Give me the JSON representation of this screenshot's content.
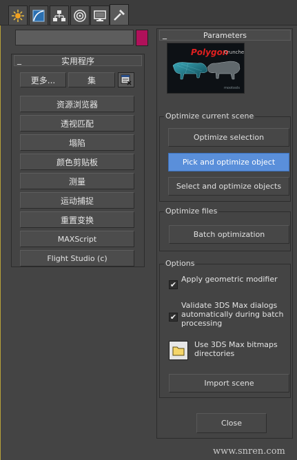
{
  "tabs": [
    {
      "icon": "create-icon"
    },
    {
      "icon": "modify-icon"
    },
    {
      "icon": "hierarchy-icon"
    },
    {
      "icon": "motion-icon"
    },
    {
      "icon": "display-icon"
    },
    {
      "icon": "utilities-icon",
      "active": true
    }
  ],
  "colors": {
    "swatch": "#b0115a",
    "accent_button": "#5a8fda",
    "logo_title": "#e12020"
  },
  "utilities": {
    "title": "实用程序",
    "more_label": "更多...",
    "sets_label": "集",
    "items": [
      "资源浏览器",
      "透视匹配",
      "塌陷",
      "颜色剪贴板",
      "测量",
      "运动捕捉",
      "重置变换",
      "MAXScript",
      "Flight Studio (c)"
    ]
  },
  "parameters": {
    "title": "Parameters",
    "logo": {
      "title": "Polygon",
      "subtitle": "Cruncher",
      "brand": "mootools"
    },
    "optimize_scene": {
      "label": "Optimize current scene",
      "buttons": [
        "Optimize selection",
        "Pick and optimize object",
        "Select and optimize objects"
      ],
      "active_index": 1
    },
    "optimize_files": {
      "label": "Optimize files",
      "batch_label": "Batch optimization"
    },
    "options": {
      "label": "Options",
      "apply_modifier": {
        "label": "Apply geometric modifier",
        "checked": true
      },
      "validate_dialogs": {
        "label": "Validate 3DS Max dialogs automatically during batch processing",
        "checked": true
      },
      "use_bitmaps": {
        "label": "Use 3DS Max bitmaps directories"
      },
      "import_label": "Import scene"
    },
    "close_label": "Close"
  },
  "watermark": "www.snren.com"
}
